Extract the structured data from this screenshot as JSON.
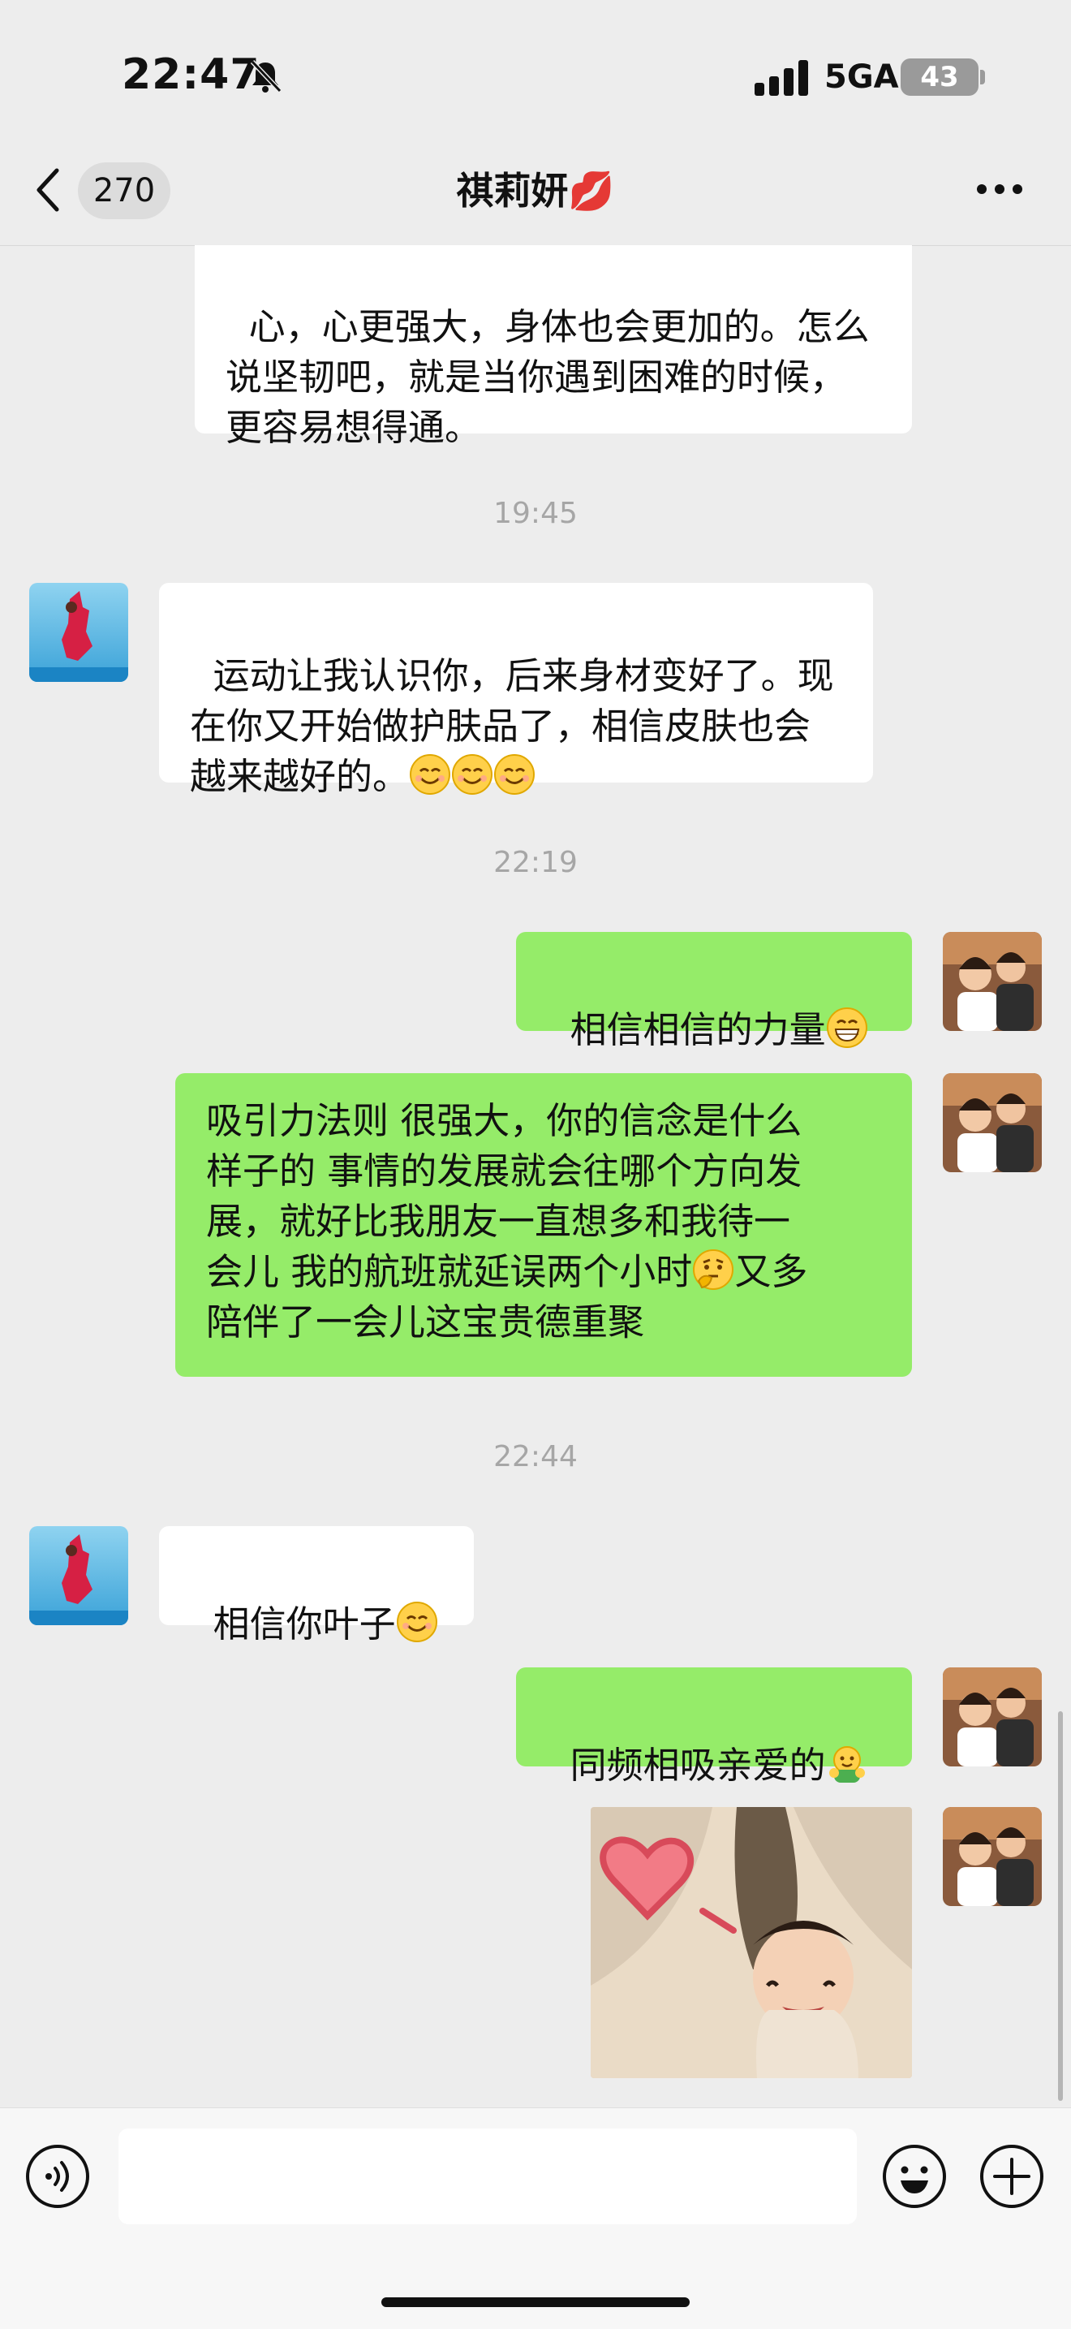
{
  "status_bar": {
    "time": "22:47",
    "network": "5GA",
    "battery": "43",
    "icons": [
      "bell-slash-icon",
      "signal-icon",
      "battery-icon"
    ]
  },
  "nav": {
    "unread_count": "270",
    "title": "祺莉妍💋",
    "icons": [
      "chevron-left-icon",
      "more-icon"
    ]
  },
  "messages": [
    {
      "side": "left",
      "text": "心，心更强大，身体也会更加的。怎么说坚韧吧，就是当你遇到困难的时候，更容易想得通。"
    },
    {
      "type": "time",
      "text": "19:45"
    },
    {
      "side": "left",
      "text": "运动让我认识你，后来身材变好了。现在你又开始做护肤品了，相信皮肤也会越来越好的。",
      "emojis": [
        "smiling-face-icon",
        "smiling-face-icon",
        "smiling-face-icon"
      ]
    },
    {
      "type": "time",
      "text": "22:19"
    },
    {
      "side": "right",
      "text": "相信相信的力量",
      "emojis": [
        "grinning-face-icon"
      ]
    },
    {
      "side": "right",
      "lines": [
        "吸引力法则 很强大，你的信念是什么",
        "样子的 事情的发展就会往哪个方向发",
        "展，就好比我朋友一直想多和我待一",
        "会儿 我的航班就延误两个小时",
        "陪伴了一会儿这宝贵德重聚"
      ],
      "inline_tail": "又多",
      "emojis": [
        "thinking-face-icon"
      ]
    },
    {
      "type": "time",
      "text": "22:44"
    },
    {
      "side": "left",
      "text": "相信你叶子",
      "emojis": [
        "smiling-face-icon"
      ]
    },
    {
      "side": "right",
      "text": "同频相吸亲爱的",
      "emojis": [
        "hug-icon"
      ]
    },
    {
      "side": "right",
      "type": "image",
      "content": "sticker-heart-child"
    }
  ],
  "input_bar": {
    "placeholder": "",
    "icons": [
      "voice-icon",
      "emoji-icon",
      "plus-icon"
    ]
  },
  "colors": {
    "background": "#ededed",
    "self_bubble": "#95ec69",
    "other_bubble": "#ffffff",
    "timestamp": "#a6a6a6"
  }
}
